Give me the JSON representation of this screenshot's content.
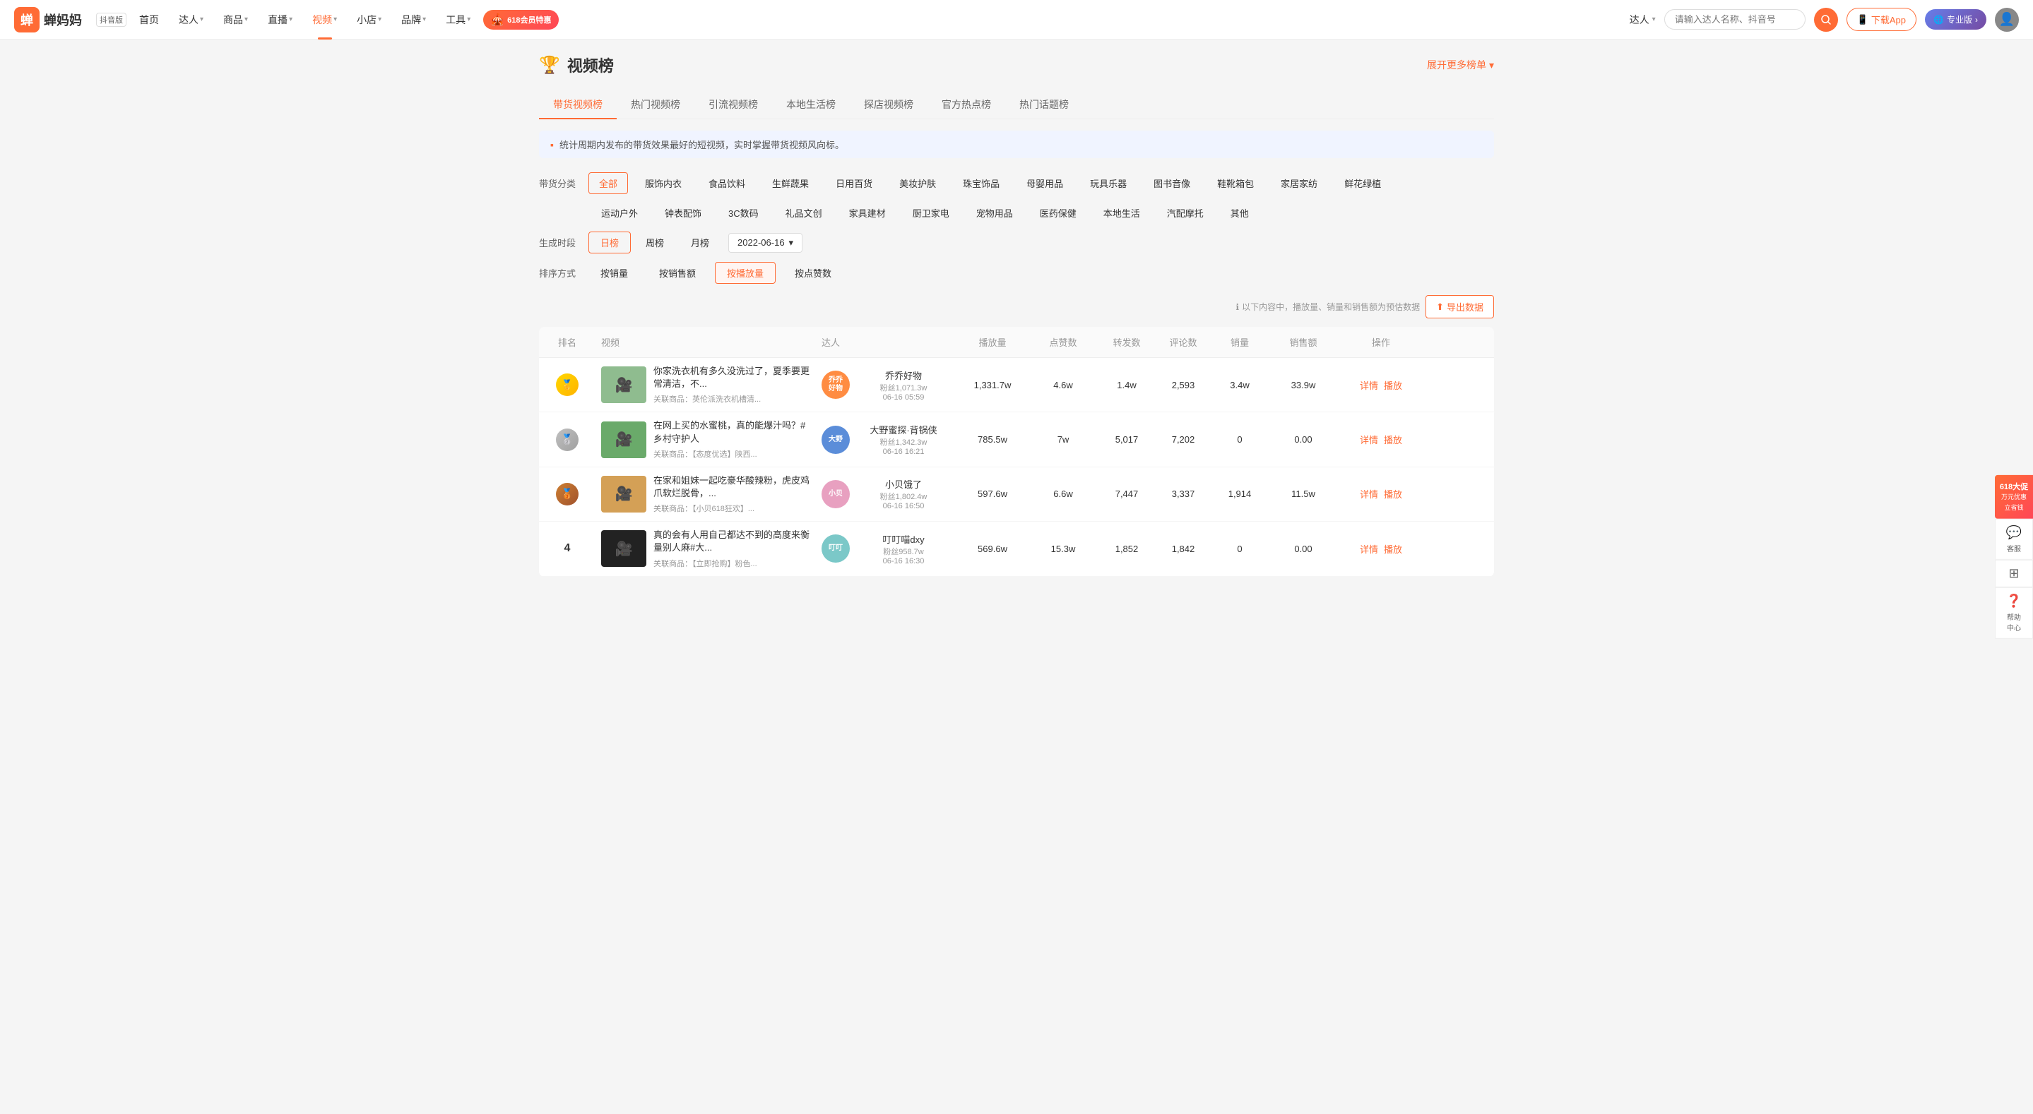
{
  "app": {
    "logo_text": "蝉妈妈",
    "version": "抖音版",
    "nav_items": [
      {
        "label": "首页",
        "arrow": false,
        "active": false
      },
      {
        "label": "达人",
        "arrow": true,
        "active": false
      },
      {
        "label": "商品",
        "arrow": true,
        "active": false
      },
      {
        "label": "直播",
        "arrow": true,
        "active": false
      },
      {
        "label": "视频",
        "arrow": true,
        "active": true
      },
      {
        "label": "小店",
        "arrow": true,
        "active": false
      },
      {
        "label": "品牌",
        "arrow": true,
        "active": false
      },
      {
        "label": "工具",
        "arrow": true,
        "active": false
      }
    ],
    "banner_618": "618会员特惠",
    "nav_right": {
      "talent_label": "达人",
      "search_placeholder": "请输入达人名称、抖音号",
      "download_label": "下载App",
      "pro_label": "专业版",
      "pro_arrow": ">"
    }
  },
  "page": {
    "title": "视频榜",
    "expand_label": "展开更多榜单",
    "trophy_icon": "🏆"
  },
  "tabs": [
    {
      "label": "带货视频榜",
      "active": true
    },
    {
      "label": "热门视频榜",
      "active": false
    },
    {
      "label": "引流视频榜",
      "active": false
    },
    {
      "label": "本地生活榜",
      "active": false
    },
    {
      "label": "探店视频榜",
      "active": false
    },
    {
      "label": "官方热点榜",
      "active": false
    },
    {
      "label": "热门话题榜",
      "active": false
    }
  ],
  "info_bar": {
    "icon": "▪",
    "text": "统计周期内发布的带货效果最好的短视频，实时掌握带货视频风向标。"
  },
  "filters": {
    "category_label": "带货分类",
    "categories_row1": [
      {
        "label": "全部",
        "active": true
      },
      {
        "label": "服饰内衣",
        "active": false
      },
      {
        "label": "食品饮料",
        "active": false
      },
      {
        "label": "生鲜蔬果",
        "active": false
      },
      {
        "label": "日用百货",
        "active": false
      },
      {
        "label": "美妆护肤",
        "active": false
      },
      {
        "label": "珠宝饰品",
        "active": false
      },
      {
        "label": "母婴用品",
        "active": false
      },
      {
        "label": "玩具乐器",
        "active": false
      },
      {
        "label": "图书音像",
        "active": false
      },
      {
        "label": "鞋靴箱包",
        "active": false
      },
      {
        "label": "家居家纺",
        "active": false
      },
      {
        "label": "鲜花绿植",
        "active": false
      }
    ],
    "categories_row2": [
      {
        "label": "运动户外",
        "active": false
      },
      {
        "label": "钟表配饰",
        "active": false
      },
      {
        "label": "3C数码",
        "active": false
      },
      {
        "label": "礼品文创",
        "active": false
      },
      {
        "label": "家具建材",
        "active": false
      },
      {
        "label": "厨卫家电",
        "active": false
      },
      {
        "label": "宠物用品",
        "active": false
      },
      {
        "label": "医药保健",
        "active": false
      },
      {
        "label": "本地生活",
        "active": false
      },
      {
        "label": "汽配摩托",
        "active": false
      },
      {
        "label": "其他",
        "active": false
      }
    ],
    "period_label": "生成时段",
    "periods": [
      {
        "label": "日榜",
        "active": true
      },
      {
        "label": "周榜",
        "active": false
      },
      {
        "label": "月榜",
        "active": false
      }
    ],
    "date": "2022-06-16",
    "sort_label": "排序方式",
    "sorts": [
      {
        "label": "按销量",
        "active": false
      },
      {
        "label": "按销售额",
        "active": false
      },
      {
        "label": "按播放量",
        "active": true
      },
      {
        "label": "按点赞数",
        "active": false
      }
    ]
  },
  "table": {
    "hint": "以下内容中，播放量、销量和销售额为预估数据",
    "export_label": "导出数据",
    "columns": [
      "排名",
      "视频",
      "达人",
      "播放量",
      "点赞数",
      "转发数",
      "评论数",
      "销量",
      "销售额",
      "操作"
    ],
    "rows": [
      {
        "rank": "1",
        "rank_type": "gold",
        "video_title": "你家洗衣机有多久没洗过了，夏季要更常清洁，不...",
        "video_product": "关联商品：英伦派洗衣机槽清...",
        "video_thumb_color": "#8fbc8f",
        "talent_name": "乔乔好物",
        "talent_avatar_text": "乔乔\n好物",
        "talent_avatar_color": "#ff8c42",
        "talent_fans": "粉丝1,071.3w",
        "talent_time": "06-16 05:59",
        "plays": "1,331.7w",
        "likes": "4.6w",
        "shares": "1.4w",
        "comments": "2,593",
        "sales": "3.4w",
        "revenue": "33.9w"
      },
      {
        "rank": "2",
        "rank_type": "silver",
        "video_title": "在网上买的水蜜桃，真的能爆汁吗？#乡村守护人",
        "video_product": "关联商品：【态度优选】陕西...",
        "video_thumb_color": "#6aaa6a",
        "talent_name": "大野蜜探·背锅侠",
        "talent_avatar_text": "大野",
        "talent_avatar_color": "#5b8dd9",
        "talent_fans": "粉丝1,342.3w",
        "talent_time": "06-16 16:21",
        "plays": "785.5w",
        "likes": "7w",
        "shares": "5,017",
        "comments": "7,202",
        "sales": "0",
        "revenue": "0.00"
      },
      {
        "rank": "3",
        "rank_type": "bronze",
        "video_title": "在家和姐妹一起吃豪华酸辣粉，虎皮鸡爪软烂脱骨，...",
        "video_product": "关联商品：【小贝618狂欢】...",
        "video_thumb_color": "#d4a056",
        "talent_name": "小贝饿了",
        "talent_avatar_text": "小贝",
        "talent_avatar_color": "#e8a0c0",
        "talent_fans": "粉丝1,802.4w",
        "talent_time": "06-16 16:50",
        "plays": "597.6w",
        "likes": "6.6w",
        "shares": "7,447",
        "comments": "3,337",
        "sales": "1,914",
        "revenue": "11.5w"
      },
      {
        "rank": "4",
        "rank_type": "num",
        "video_title": "真的会有人用自己都达不到的高度来衡量别人麻#大...",
        "video_product": "关联商品：【立即抢购】粉色...",
        "video_thumb_color": "#222222",
        "talent_name": "叮叮喵dxy",
        "talent_avatar_text": "叮叮",
        "talent_avatar_color": "#7bc8c8",
        "talent_fans": "粉丝958.7w",
        "talent_time": "06-16 16:30",
        "plays": "569.6w",
        "likes": "15.3w",
        "shares": "1,852",
        "comments": "1,842",
        "sales": "0",
        "revenue": "0.00"
      }
    ]
  },
  "right_widget": {
    "title_618": "618大促",
    "sub_618": "万元优惠",
    "link_618": "立省钱",
    "items": [
      {
        "icon": "😊",
        "label": "客服"
      },
      {
        "icon": "⊞",
        "label": ""
      },
      {
        "icon": "❓",
        "label": "帮助\n中心"
      }
    ]
  }
}
